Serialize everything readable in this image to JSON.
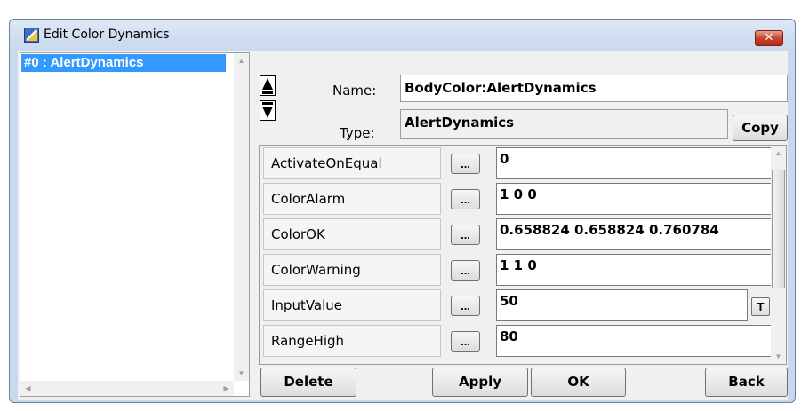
{
  "window": {
    "title": "Edit Color Dynamics",
    "close_label": "✕"
  },
  "list": {
    "items": [
      {
        "label": "#0 : AlertDynamics",
        "selected": true
      }
    ]
  },
  "form": {
    "name_label": "Name:",
    "name_value": "BodyColor:AlertDynamics",
    "type_label": "Type:",
    "type_value": "AlertDynamics",
    "copy_label": "Copy"
  },
  "properties": [
    {
      "name": "ActivateOnEqual",
      "dots": "...",
      "value": "0"
    },
    {
      "name": "ColorAlarm",
      "dots": "...",
      "value": "1 0 0"
    },
    {
      "name": "ColorOK",
      "dots": "...",
      "value": "0.658824 0.658824 0.760784"
    },
    {
      "name": "ColorWarning",
      "dots": "...",
      "value": "1 1 0"
    },
    {
      "name": "InputValue",
      "dots": "...",
      "value": "50",
      "extra_button": "T"
    },
    {
      "name": "RangeHigh",
      "dots": "...",
      "value": "80"
    }
  ],
  "buttons": {
    "delete": "Delete",
    "apply": "Apply",
    "ok": "OK",
    "back": "Back"
  },
  "colors": {
    "selection": "#3399ff",
    "title_gradient": "#cfdcf0",
    "close_button": "#c9452d"
  }
}
